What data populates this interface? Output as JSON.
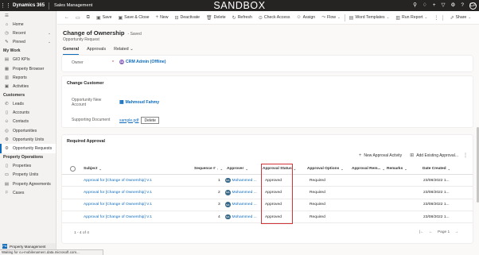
{
  "topbar": {
    "brand": "Dynamics 365",
    "app_name": "Sales Management",
    "environment": "SANDBOX",
    "user_initials": "CA",
    "icons": [
      "search-icon",
      "lightbulb-icon",
      "plus-icon",
      "filter-icon",
      "gear-icon",
      "help-icon",
      "user-avatar"
    ]
  },
  "sidebar": {
    "top_items": [
      {
        "label": "Home",
        "icon": "home-icon"
      },
      {
        "label": "Recent",
        "icon": "clock-icon"
      },
      {
        "label": "Pinned",
        "icon": "pin-icon"
      }
    ],
    "groups": [
      {
        "title": "My Work",
        "items": [
          {
            "label": "GIO KPIs",
            "icon": "chart-icon"
          },
          {
            "label": "Property Browser",
            "icon": "browser-icon"
          },
          {
            "label": "Reports",
            "icon": "report-icon"
          },
          {
            "label": "Activities",
            "icon": "activity-icon"
          }
        ]
      },
      {
        "title": "Customers",
        "items": [
          {
            "label": "Leads",
            "icon": "phone-icon"
          },
          {
            "label": "Accounts",
            "icon": "building-icon"
          },
          {
            "label": "Contacts",
            "icon": "person-icon"
          },
          {
            "label": "Opportunities",
            "icon": "opportunity-icon"
          },
          {
            "label": "Opportunity Units",
            "icon": "gear-icon"
          },
          {
            "label": "Opportunity Requests",
            "icon": "request-icon",
            "active": true
          }
        ]
      },
      {
        "title": "Property Operations",
        "items": [
          {
            "label": "Properties",
            "icon": "building-icon"
          },
          {
            "label": "Property Units",
            "icon": "unit-icon"
          },
          {
            "label": "Property Agreements",
            "icon": "agreement-icon"
          },
          {
            "label": "Cases",
            "icon": "case-icon"
          }
        ]
      }
    ],
    "area_switcher": "Property Management"
  },
  "commandbar": {
    "items": [
      {
        "label": "Save",
        "icon": "save-icon"
      },
      {
        "label": "Save & Close",
        "icon": "save-close-icon"
      },
      {
        "label": "New",
        "icon": "plus-icon"
      },
      {
        "label": "Deactivate",
        "icon": "deactivate-icon"
      },
      {
        "label": "Delete",
        "icon": "trash-icon"
      },
      {
        "label": "Refresh",
        "icon": "refresh-icon"
      },
      {
        "label": "Check Access",
        "icon": "check-access-icon"
      },
      {
        "label": "Assign",
        "icon": "assign-icon"
      },
      {
        "label": "Flow",
        "icon": "flow-icon",
        "dropdown": true
      },
      {
        "label": "Word Templates",
        "icon": "word-icon",
        "dropdown": true
      },
      {
        "label": "Run Report",
        "icon": "report-icon",
        "dropdown": true
      }
    ],
    "share_label": "Share"
  },
  "header": {
    "title": "Change of Ownership",
    "saved_status": "- Saved",
    "entity": "Opportunity Request",
    "tabs": [
      {
        "label": "General",
        "active": true
      },
      {
        "label": "Approvals",
        "active": false
      },
      {
        "label": "Related",
        "active": false,
        "dropdown": true
      }
    ]
  },
  "owner_section": {
    "label": "Owner",
    "required": "*",
    "initials": "CA",
    "value": "CRM Admin (Offline)"
  },
  "change_customer": {
    "title": "Change Customer",
    "new_account_label": "Opportunity New Account",
    "new_account_value": "Mahmoud Fahmy",
    "supporting_doc_label": "Supporting Document",
    "supporting_doc_file": "sample.pdf",
    "delete_label": "Delete"
  },
  "required_approval": {
    "title": "Required Approval",
    "new_activity_label": "New Approval Activity",
    "add_existing_label": "Add Existing Approval...",
    "columns": [
      "Subject",
      "Sequence #",
      "Approver",
      "Approval Status",
      "Approval Options",
      "Approval Rem...",
      "Remarks",
      "Date Created"
    ],
    "rows": [
      {
        "subject": "Approval for [Change of Ownership] V.1",
        "sequence": "1",
        "approver_initials": "MA",
        "approver": "Mohammed ...",
        "status": "Approved",
        "options": "Required",
        "date": "23/08/2022 1..."
      },
      {
        "subject": "Approval for [Change of Ownership] V.1",
        "sequence": "2",
        "approver_initials": "MA",
        "approver": "Mohammed ...",
        "status": "Approved",
        "options": "Required",
        "date": "23/08/2022 1..."
      },
      {
        "subject": "Approval for [Change of Ownership] V.1",
        "sequence": "3",
        "approver_initials": "MA",
        "approver": "Mohammed ...",
        "status": "Approved",
        "options": "Required",
        "date": "23/08/2022 1..."
      },
      {
        "subject": "Approval for [Change of Ownership] V.1",
        "sequence": "4",
        "approver_initials": "MA",
        "approver": "Mohammed ...",
        "status": "Approved",
        "options": "Required",
        "date": "23/08/2022 1..."
      }
    ],
    "record_count": "1 - 4 of 4",
    "page_label": "Page 1"
  },
  "status_bar": "Waiting for cu-mobilenamerc.data.microsoft.com...",
  "colors": {
    "accent": "#0f6cbd",
    "topbar": "#252423",
    "highlight": "#d13438"
  }
}
